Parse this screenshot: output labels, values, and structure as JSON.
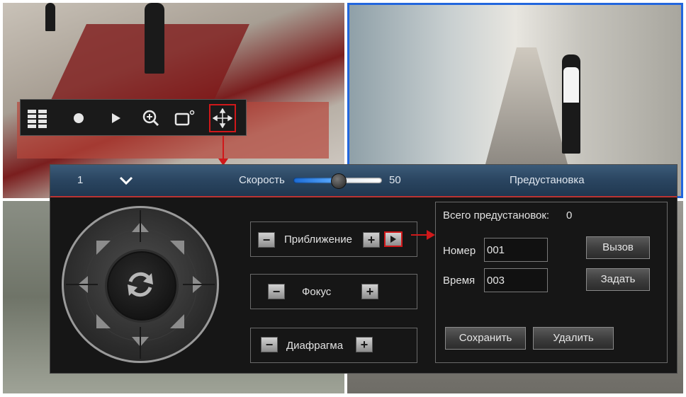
{
  "toolbar": {
    "buttons": [
      {
        "name": "layout",
        "icon": "layout-grid-icon"
      },
      {
        "name": "record",
        "icon": "record-dot-icon"
      },
      {
        "name": "play",
        "icon": "play-icon"
      },
      {
        "name": "zoom",
        "icon": "zoom-in-icon"
      },
      {
        "name": "snapshot",
        "icon": "window-icon"
      },
      {
        "name": "ptz",
        "icon": "move-arrows-icon"
      }
    ]
  },
  "ptz": {
    "header": {
      "channel": "1",
      "speed_label": "Скорость",
      "speed_value": "50",
      "speed_level": 0.5,
      "preset_title": "Предустановка"
    },
    "controls": {
      "zoom_label": "Приближение",
      "focus_label": "Фокус",
      "iris_label": "Диафрагма",
      "minus": "−",
      "plus": "+"
    },
    "presets": {
      "total_label": "Всего предустановок:",
      "total_value": "0",
      "number_label": "Номер",
      "number_value": "001",
      "time_label": "Время",
      "time_value": "003",
      "call_button": "Вызов",
      "set_button": "Задать",
      "save_button": "Сохранить",
      "delete_button": "Удалить"
    }
  },
  "colors": {
    "highlight": "#d0181a",
    "header": "#2a4560",
    "selected_feed_border": "#2266dd"
  }
}
